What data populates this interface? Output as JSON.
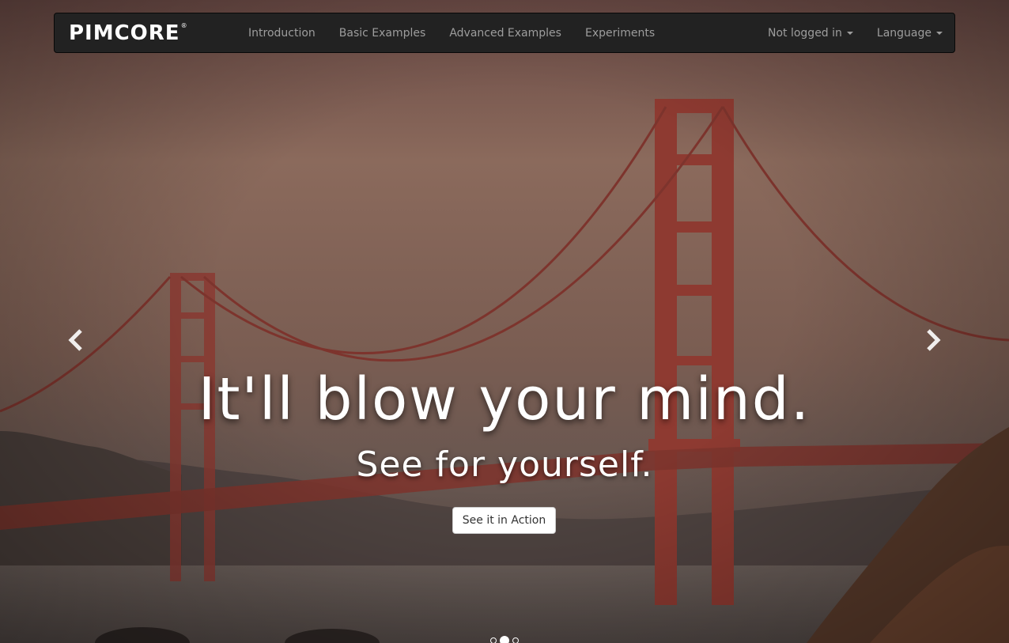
{
  "brand": {
    "name": "PIMCORE",
    "registered_mark": "®"
  },
  "nav": {
    "items": [
      {
        "label": "Introduction"
      },
      {
        "label": "Basic Examples"
      },
      {
        "label": "Advanced Examples"
      },
      {
        "label": "Experiments"
      }
    ],
    "right": [
      {
        "label": "Not logged in"
      },
      {
        "label": "Language"
      }
    ]
  },
  "hero": {
    "headline": "It'll blow your mind.",
    "subline": "See for yourself.",
    "cta_label": "See it in Action"
  },
  "carousel": {
    "slide_count": 3,
    "active_index": 1,
    "prev_icon": "chevron-left-icon",
    "next_icon": "chevron-right-icon"
  },
  "colors": {
    "navbar_bg": "#222222",
    "nav_text": "#9d9d9d",
    "bridge": "#8c3a32",
    "sky_top": "#6b4b46"
  }
}
